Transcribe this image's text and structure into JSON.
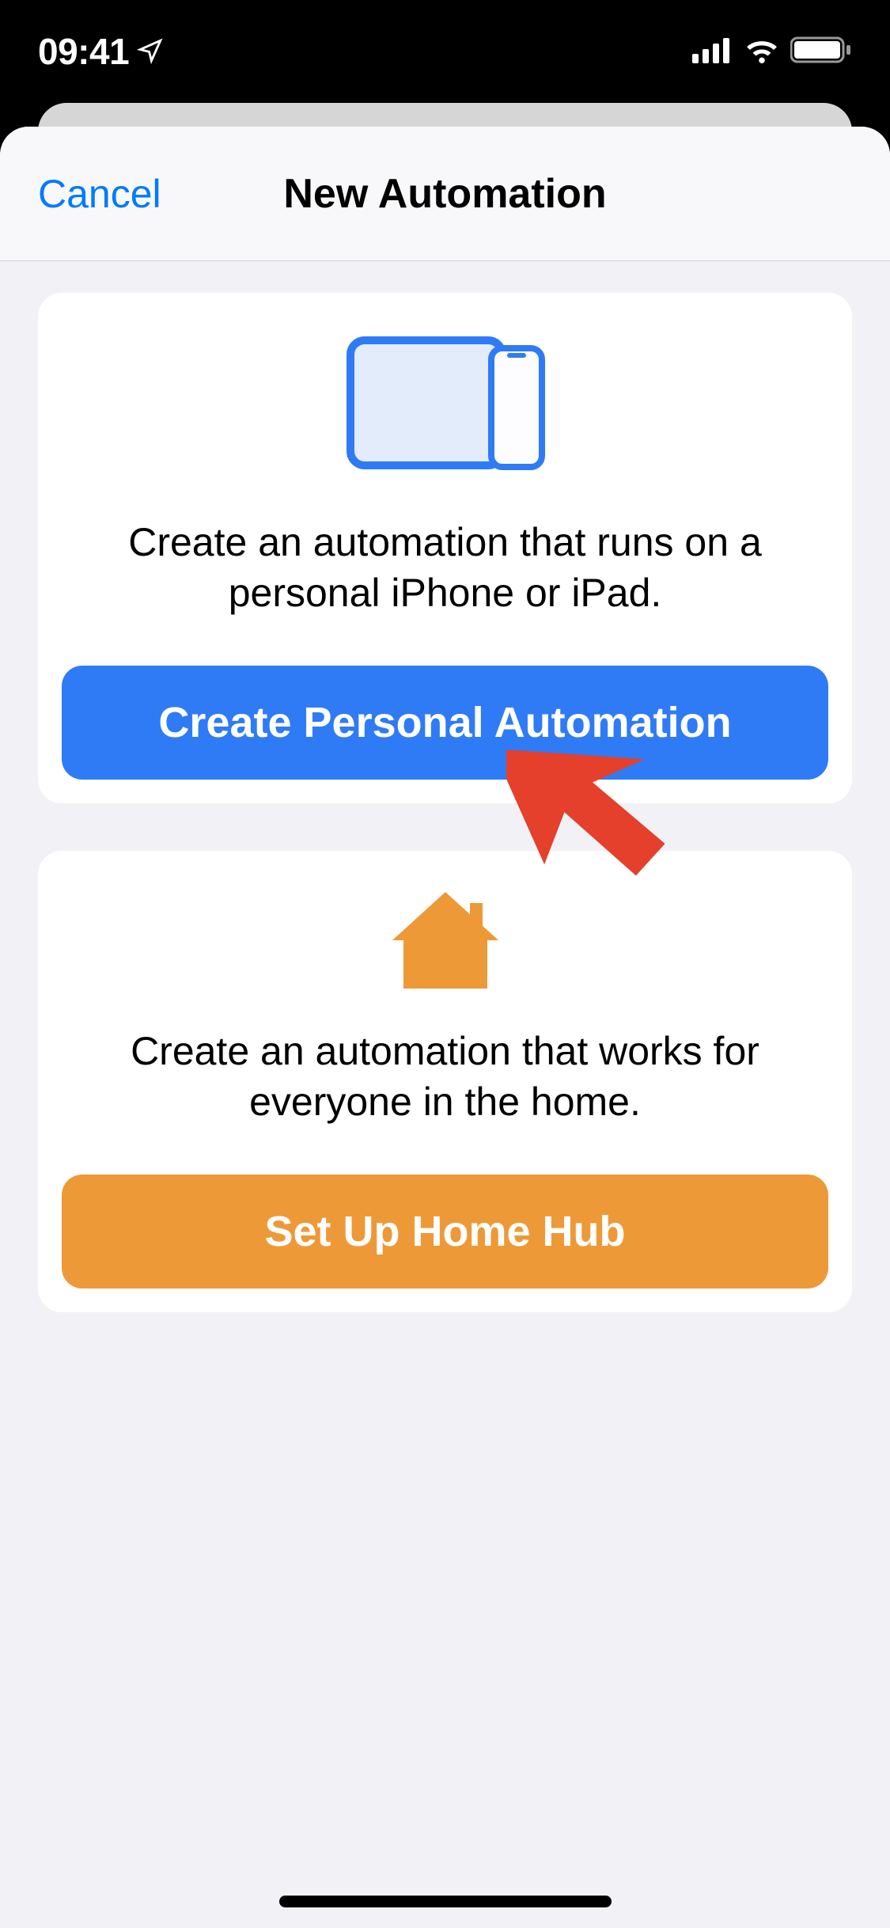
{
  "status": {
    "time": "09:41"
  },
  "nav": {
    "cancel_label": "Cancel",
    "title": "New Automation"
  },
  "cards": {
    "personal": {
      "description": "Create an automation that runs on a personal iPhone or iPad.",
      "button_label": "Create Personal Automation"
    },
    "home": {
      "description": "Create an automation that works for everyone in the home.",
      "button_label": "Set Up Home Hub"
    }
  },
  "colors": {
    "accent_blue": "#2f7bf6",
    "accent_orange": "#ee9938",
    "link_blue": "#007aff"
  }
}
